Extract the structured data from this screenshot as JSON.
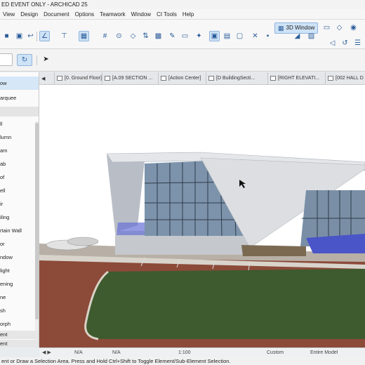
{
  "app": {
    "title": "ED  EVENT ONLY - ARCHICAD 25"
  },
  "menu": [
    "View",
    "Design",
    "Document",
    "Options",
    "Teamwork",
    "Window",
    "CI Tools",
    "Help"
  ],
  "toolbar": {
    "view_3d_label": "3D Window"
  },
  "sidebar": {
    "items": [
      "ow",
      "arquee",
      "ll",
      "lumn",
      "am",
      "ab",
      "of",
      "ell",
      "ir",
      "iling",
      "rtain Wall",
      "or",
      "ndow",
      "light",
      "ening",
      "ne",
      "sh",
      "orph"
    ],
    "selected_index": 0,
    "bottom_items": [
      "ent",
      "ent"
    ]
  },
  "tabs": [
    "[0. Ground Floor]",
    "[A.09 SECTION ...",
    "[Action Center]",
    "[D BuildingSecti...",
    "[RIGHT ELEVATI...",
    "[002 HALL D"
  ],
  "status": {
    "na1": "N/A",
    "na2": "N/A",
    "scale": "1:100",
    "custom": "Custom",
    "entire_model": "Entire Model"
  },
  "hint_text": "ent or Draw a Selection Area. Press and Hold Ctrl+Shift to Toggle Element/Sub-Element Selection.",
  "colors": {
    "accent": "#2a5c9a",
    "selection": "#cfe3f7",
    "lawn": "#3a5a2c",
    "paving": "#8a4a38"
  }
}
